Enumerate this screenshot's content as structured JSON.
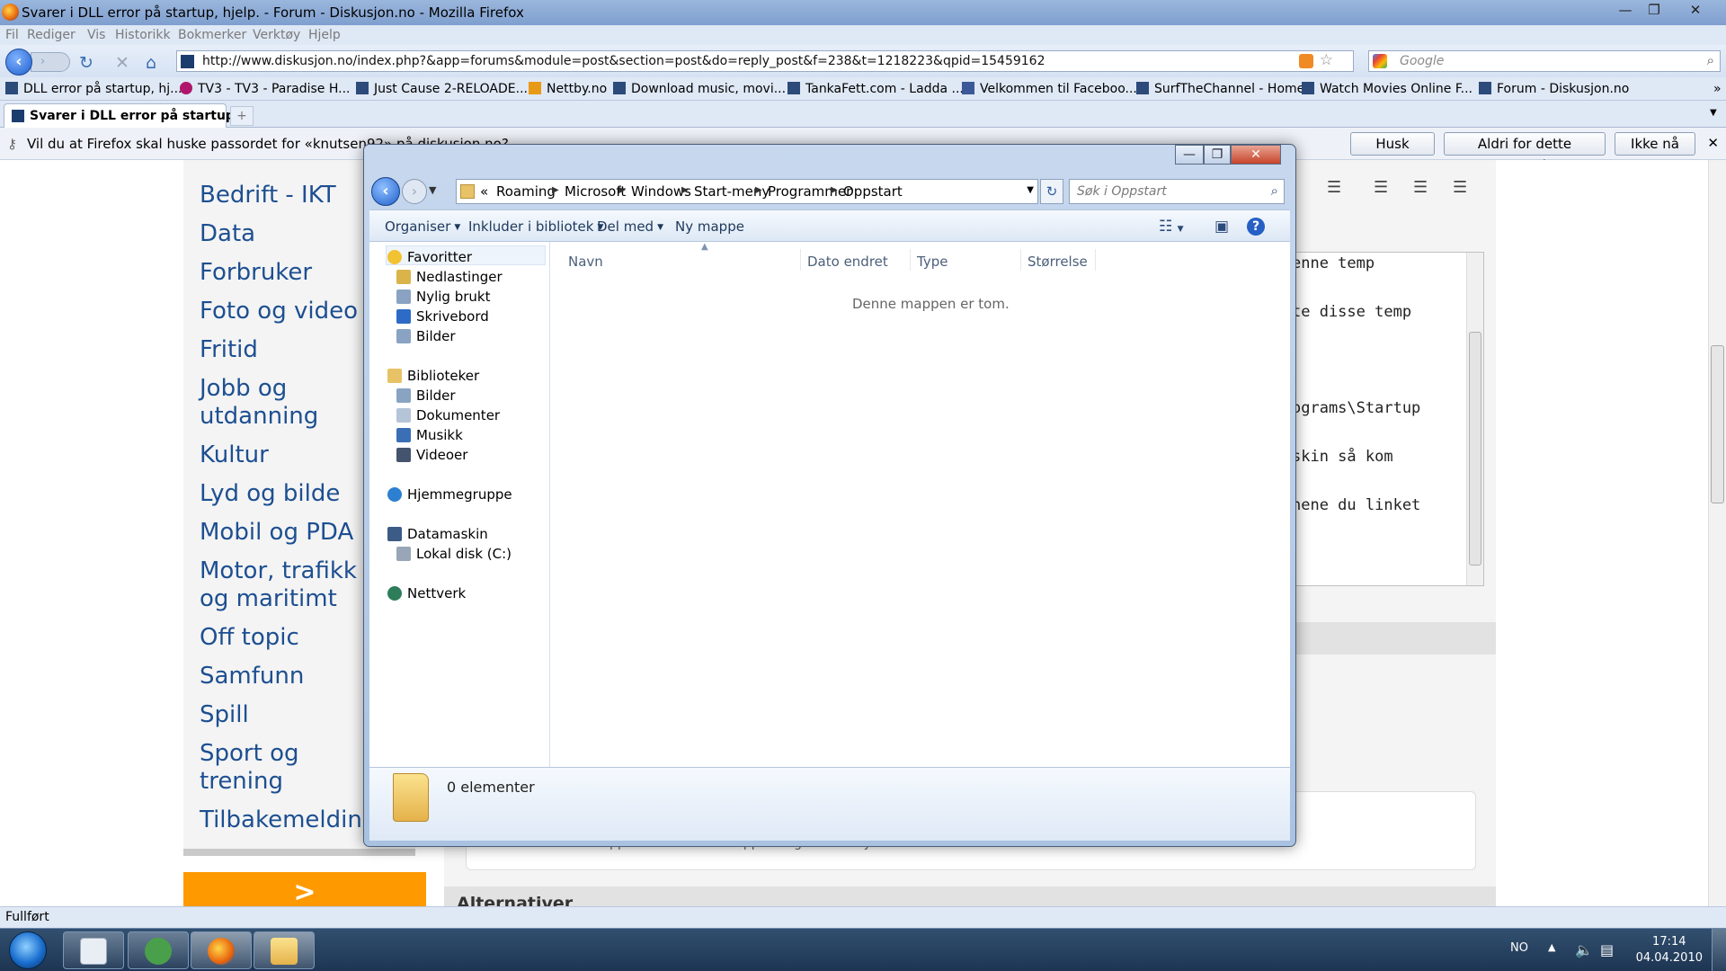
{
  "window": {
    "title": "Svarer i DLL error på startup, hjelp. - Forum - Diskusjon.no - Mozilla Firefox",
    "minimize": "—",
    "maximize": "❐",
    "close": "✕"
  },
  "menu": [
    "Fil",
    "Rediger",
    "Vis",
    "Historikk",
    "Bokmerker",
    "Verktøy",
    "Hjelp"
  ],
  "nav": {
    "url": "http://www.diskusjon.no/index.php?&app=forums&module=post&section=post&do=reply_post&f=238&t=1218223&qpid=15459162",
    "search_placeholder": "Google"
  },
  "bookmarks": [
    "DLL error på startup, hj...",
    "TV3 - TV3 - Paradise H...",
    "Just Cause 2-RELOADE...",
    "Nettby.no",
    "Download music, movi...",
    "TankaFett.com - Ladda ...",
    "Velkommen til Faceboo...",
    "SurfTheChannel - Home",
    "Watch Movies Online F...",
    "Forum - Diskusjon.no"
  ],
  "tabs": [
    {
      "label": "Svarer i DLL error på startup,..."
    }
  ],
  "password_bar": {
    "message": "Vil du at Firefox skal huske passordet for «knutsen92» på diskusjon.no?",
    "remember": "Husk",
    "never": "Aldri for dette nettstedet",
    "not_now": "Ikke nå"
  },
  "categories": [
    "Bedrift - IKT",
    "Data",
    "Forbruker",
    "Foto og video",
    "Fritid",
    "Jobb og",
    "utdanning",
    "Kultur",
    "Lyd og bilde",
    "Mobil og PDA",
    "Motor, trafikk",
    "og maritimt",
    "Off topic",
    "Samfunn",
    "Spill",
    "Sport og",
    "trening",
    "Tilbakemelding"
  ],
  "orange_button": ">",
  "editor_lines": [
    "enne temp",
    "te disse temp",
    "ograms\\Startup",
    "skin så kom",
    "nene du linket"
  ],
  "lower_text": "for å overvåke oppstart som starter opp stadig etter at systemet",
  "alt_heading": "Alternativer",
  "explorer": {
    "breadcrumb": [
      "«",
      "Roaming",
      "Microsoft",
      "Windows",
      "Start-meny",
      "Programmer",
      "Oppstart"
    ],
    "search_placeholder": "Søk i Oppstart",
    "commands": {
      "organize": "Organiser",
      "include": "Inkluder i bibliotek",
      "share": "Del med",
      "new_folder": "Ny mappe"
    },
    "nav": {
      "favorites": "Favoritter",
      "favorites_items": [
        "Nedlastinger",
        "Nylig brukt",
        "Skrivebord",
        "Bilder"
      ],
      "libraries": "Biblioteker",
      "libraries_items": [
        "Bilder",
        "Dokumenter",
        "Musikk",
        "Videoer"
      ],
      "homegroup": "Hjemmegruppe",
      "computer": "Datamaskin",
      "computer_items": [
        "Lokal disk (C:)"
      ],
      "network": "Nettverk"
    },
    "columns": [
      "Navn",
      "Dato endret",
      "Type",
      "Størrelse"
    ],
    "empty_message": "Denne mappen er tom.",
    "item_count": "0 elementer"
  },
  "status": "Fullført",
  "tray": {
    "language": "NO",
    "time": "17:14",
    "date": "04.04.2010"
  }
}
